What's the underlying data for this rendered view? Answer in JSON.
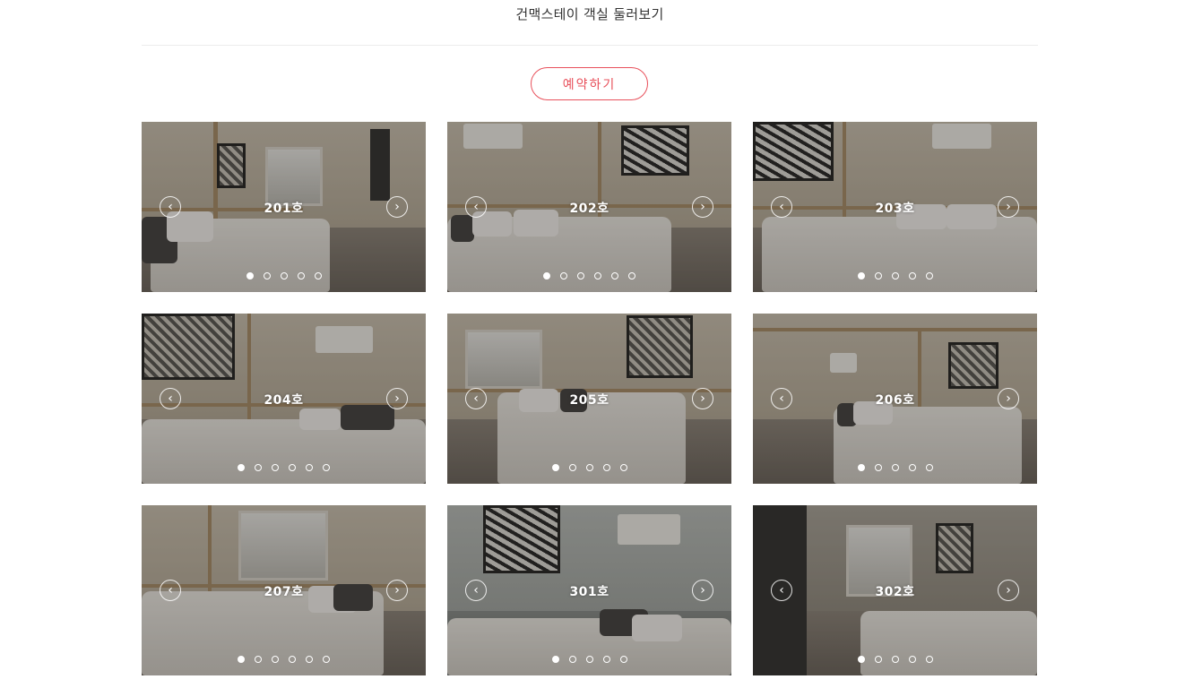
{
  "header": {
    "title": "건맥스테이 객실 둘러보기",
    "reserve_label": "예약하기",
    "accent_color": "#e8505b"
  },
  "icons": {
    "prev": "chevron-left-icon",
    "next": "chevron-right-icon"
  },
  "rooms": [
    {
      "label": "201호",
      "slides": 5,
      "active": 0,
      "style": "warm"
    },
    {
      "label": "202호",
      "slides": 6,
      "active": 0,
      "style": "warm"
    },
    {
      "label": "203호",
      "slides": 5,
      "active": 0,
      "style": "warm"
    },
    {
      "label": "204호",
      "slides": 6,
      "active": 0,
      "style": "warm"
    },
    {
      "label": "205호",
      "slides": 5,
      "active": 0,
      "style": "warm"
    },
    {
      "label": "206호",
      "slides": 5,
      "active": 0,
      "style": "warm"
    },
    {
      "label": "207호",
      "slides": 6,
      "active": 0,
      "style": "warm"
    },
    {
      "label": "301호",
      "slides": 5,
      "active": 0,
      "style": "gray"
    },
    {
      "label": "302호",
      "slides": 5,
      "active": 0,
      "style": "dim"
    }
  ]
}
